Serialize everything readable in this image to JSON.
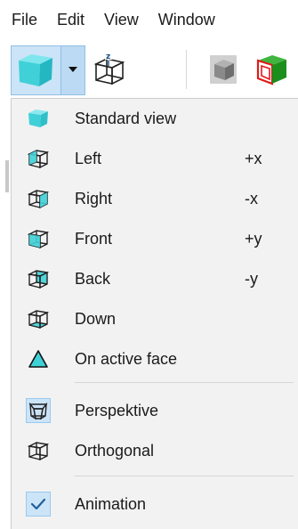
{
  "menubar": {
    "items": [
      "File",
      "Edit",
      "View",
      "Window"
    ]
  },
  "dropdown": {
    "group1": [
      {
        "label": "Standard view",
        "shortcut": "",
        "icon": "standard-view-cube-icon"
      },
      {
        "label": "Left",
        "shortcut": "+x",
        "icon": "view-left-cube-icon"
      },
      {
        "label": "Right",
        "shortcut": "-x",
        "icon": "view-right-cube-icon"
      },
      {
        "label": "Front",
        "shortcut": "+y",
        "icon": "view-front-cube-icon"
      },
      {
        "label": "Back",
        "shortcut": "-y",
        "icon": "view-back-cube-icon"
      },
      {
        "label": "Down",
        "shortcut": "",
        "icon": "view-down-cube-icon"
      },
      {
        "label": "On active face",
        "shortcut": "",
        "icon": "active-face-triangle-icon"
      }
    ],
    "group2": [
      {
        "label": "Perspektive",
        "checked": true,
        "icon": "perspective-cube-icon"
      },
      {
        "label": "Orthogonal",
        "checked": false,
        "icon": "orthogonal-cube-icon"
      }
    ],
    "group3": [
      {
        "label": "Animation",
        "checked": true,
        "icon": "checkmark-icon"
      }
    ]
  },
  "colors": {
    "accent": "#40d0d8",
    "highlight": "#cce4f7"
  }
}
